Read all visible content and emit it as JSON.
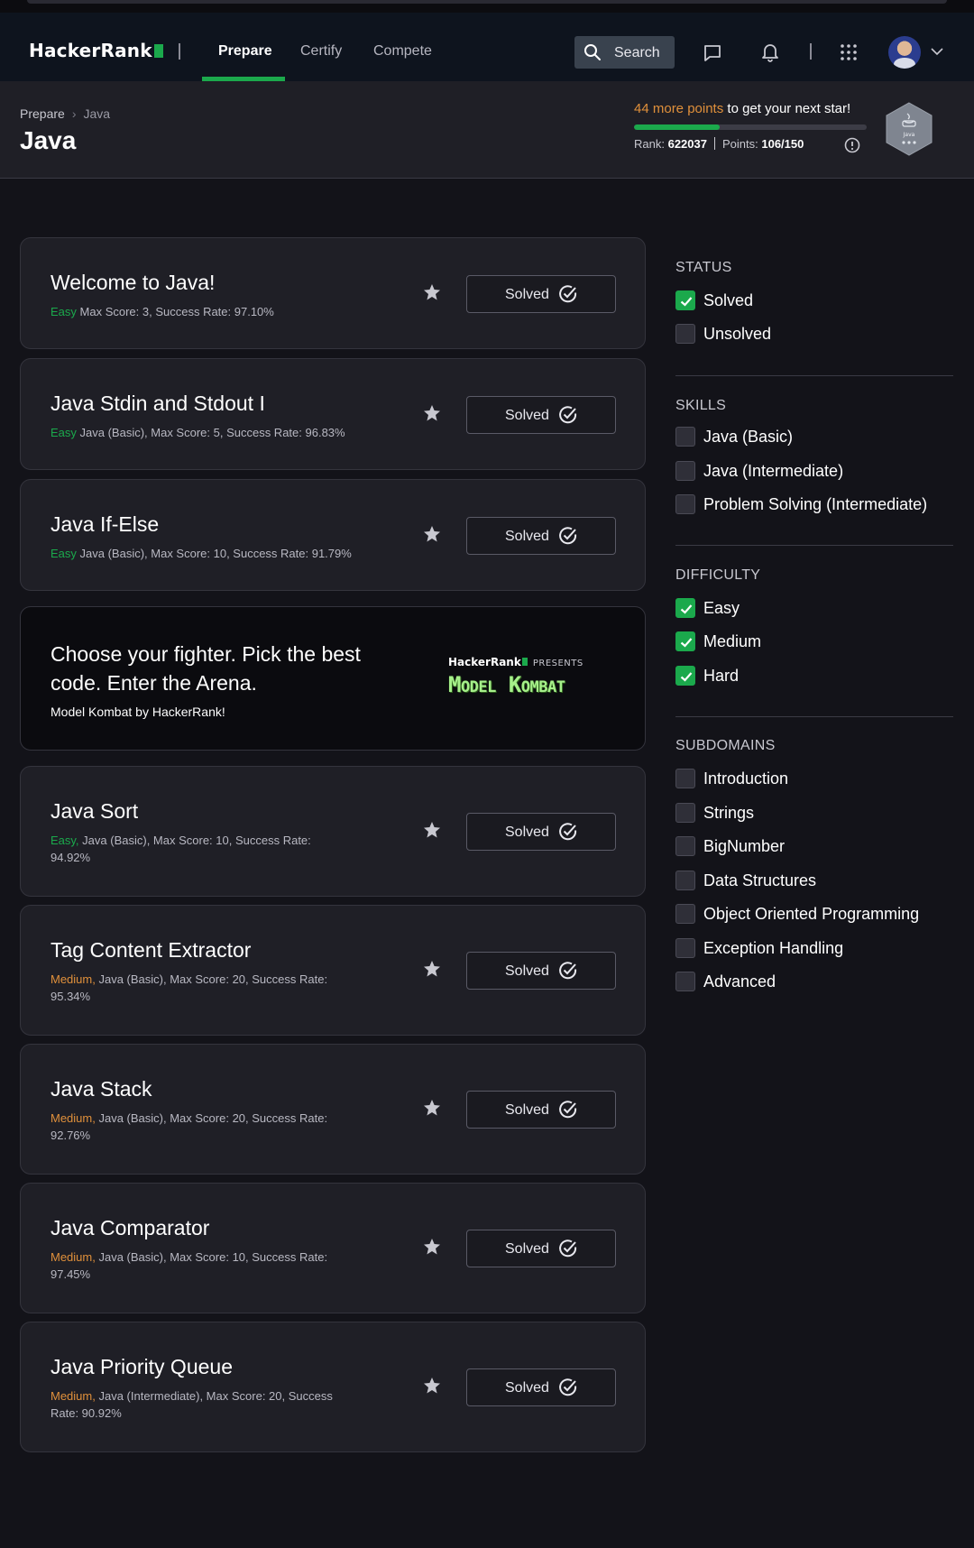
{
  "nav": {
    "logo": "HackerRank",
    "items": [
      "Prepare",
      "Certify",
      "Compete"
    ],
    "search_label": "Search"
  },
  "header": {
    "breadcrumb": [
      "Prepare",
      "Java"
    ],
    "title": "Java",
    "points_highlight": "44 more points",
    "points_rest": " to get your next star!",
    "progress_fraction": 0.37,
    "rank_label": "Rank:",
    "rank_value": "622037",
    "points_label": "Points:",
    "points_value": "106/150",
    "badge_label": "Java"
  },
  "challenges": [
    {
      "title": "Welcome to Java!",
      "difficulty": "Easy",
      "meta": " Max Score: 3, Success Rate: 97.10%",
      "status": "Solved"
    },
    {
      "title": "Java Stdin and Stdout I",
      "difficulty": "Easy",
      "meta": " Java (Basic), Max Score: 5, Success Rate: 96.83%",
      "status": "Solved"
    },
    {
      "title": "Java If-Else",
      "difficulty": "Easy",
      "meta": " Java (Basic), Max Score: 10, Success Rate: 91.79%",
      "status": "Solved"
    },
    {
      "title": "Java Sort",
      "difficulty": "Easy,",
      "meta": " Java (Basic), Max Score: 10, Success Rate: 94.92%",
      "status": "Solved"
    },
    {
      "title": "Tag Content Extractor",
      "difficulty": "Medium,",
      "meta": " Java (Basic), Max Score: 20, Success Rate: 95.34%",
      "status": "Solved"
    },
    {
      "title": "Java Stack",
      "difficulty": "Medium,",
      "meta": " Java (Basic), Max Score: 20, Success Rate: 92.76%",
      "status": "Solved"
    },
    {
      "title": "Java Comparator",
      "difficulty": "Medium,",
      "meta": " Java (Basic), Max Score: 10, Success Rate: 97.45%",
      "status": "Solved"
    },
    {
      "title": "Java Priority Queue",
      "difficulty": "Medium,",
      "meta": " Java (Intermediate), Max Score: 20, Success Rate: 90.92%",
      "status": "Solved"
    }
  ],
  "promo": {
    "headline": "Choose your fighter. Pick the best code. Enter the Arena.",
    "subtitle": "Model Kombat by HackerRank!",
    "brand": "HackerRank",
    "presents": "PRESENTS",
    "logo_text": "Model Kombat"
  },
  "filters": {
    "status": {
      "heading": "STATUS",
      "items": [
        {
          "label": "Solved",
          "checked": true
        },
        {
          "label": "Unsolved",
          "checked": false
        }
      ]
    },
    "skills": {
      "heading": "SKILLS",
      "items": [
        {
          "label": "Java (Basic)",
          "checked": false
        },
        {
          "label": "Java (Intermediate)",
          "checked": false
        },
        {
          "label": "Problem Solving (Intermediate)",
          "checked": false
        }
      ]
    },
    "difficulty": {
      "heading": "DIFFICULTY",
      "items": [
        {
          "label": "Easy",
          "checked": true
        },
        {
          "label": "Medium",
          "checked": true
        },
        {
          "label": "Hard",
          "checked": true
        }
      ]
    },
    "subdomains": {
      "heading": "SUBDOMAINS",
      "items": [
        {
          "label": "Introduction",
          "checked": false
        },
        {
          "label": "Strings",
          "checked": false
        },
        {
          "label": "BigNumber",
          "checked": false
        },
        {
          "label": "Data Structures",
          "checked": false
        },
        {
          "label": "Object Oriented Programming",
          "checked": false
        },
        {
          "label": "Exception Handling",
          "checked": false
        },
        {
          "label": "Advanced",
          "checked": false
        }
      ]
    }
  },
  "colors": {
    "accent": "#1ba94c",
    "easy": "#1ba94c",
    "medium": "#e0903b",
    "background": "#131319",
    "card": "#1f1f26"
  }
}
